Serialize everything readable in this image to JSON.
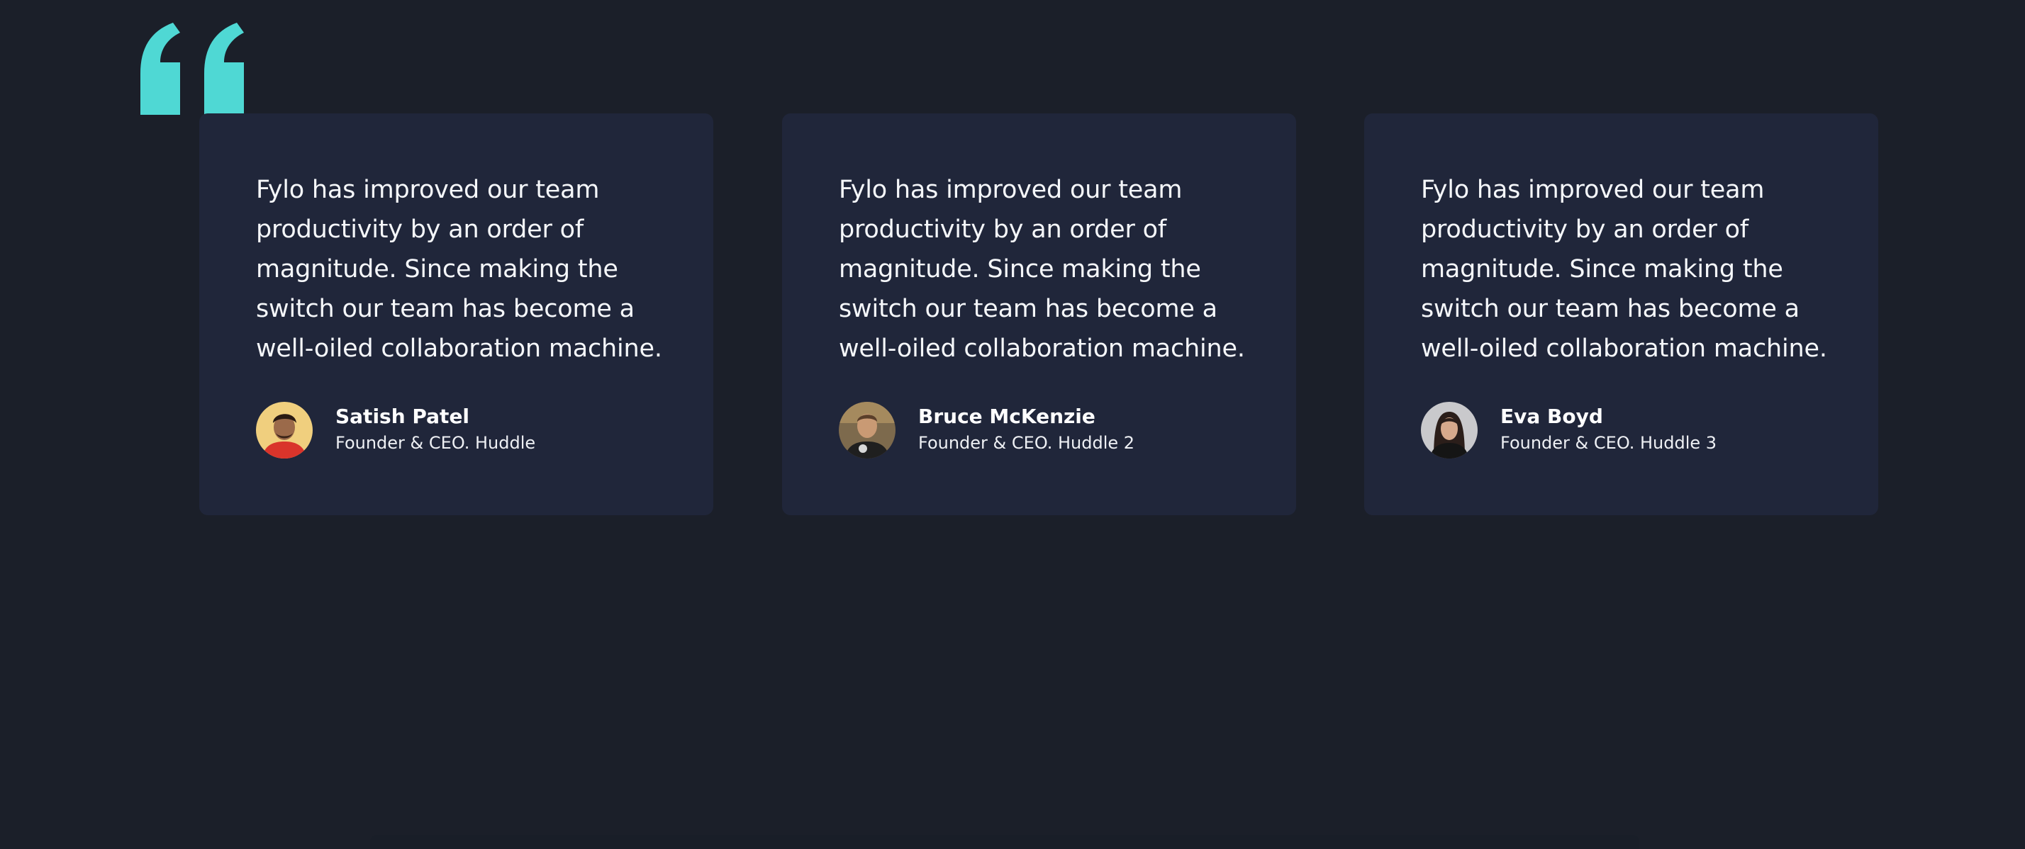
{
  "colors": {
    "background": "#1b1f29",
    "card": "#20263a",
    "accent_quote": "#4fd8d4",
    "text": "#ffffff"
  },
  "decor": {
    "quote_icon": "quote-icon"
  },
  "testimonials": [
    {
      "text": "Fylo has improved our team productivity by an order of magnitude. Since making the switch our team has become a well-oiled collaboration machine.",
      "name": "Satish Patel",
      "title": "Founder & CEO. Huddle",
      "avatar": "avatar-satish"
    },
    {
      "text": "Fylo has improved our team productivity by an order of magnitude. Since making the switch our team has become a well-oiled collaboration machine.",
      "name": "Bruce McKenzie",
      "title": "Founder & CEO. Huddle 2",
      "avatar": "avatar-bruce"
    },
    {
      "text": "Fylo has improved our team productivity by an order of magnitude. Since making the switch our team has become a well-oiled collaboration machine.",
      "name": "Eva Boyd",
      "title": "Founder & CEO. Huddle 3",
      "avatar": "avatar-eva"
    }
  ]
}
